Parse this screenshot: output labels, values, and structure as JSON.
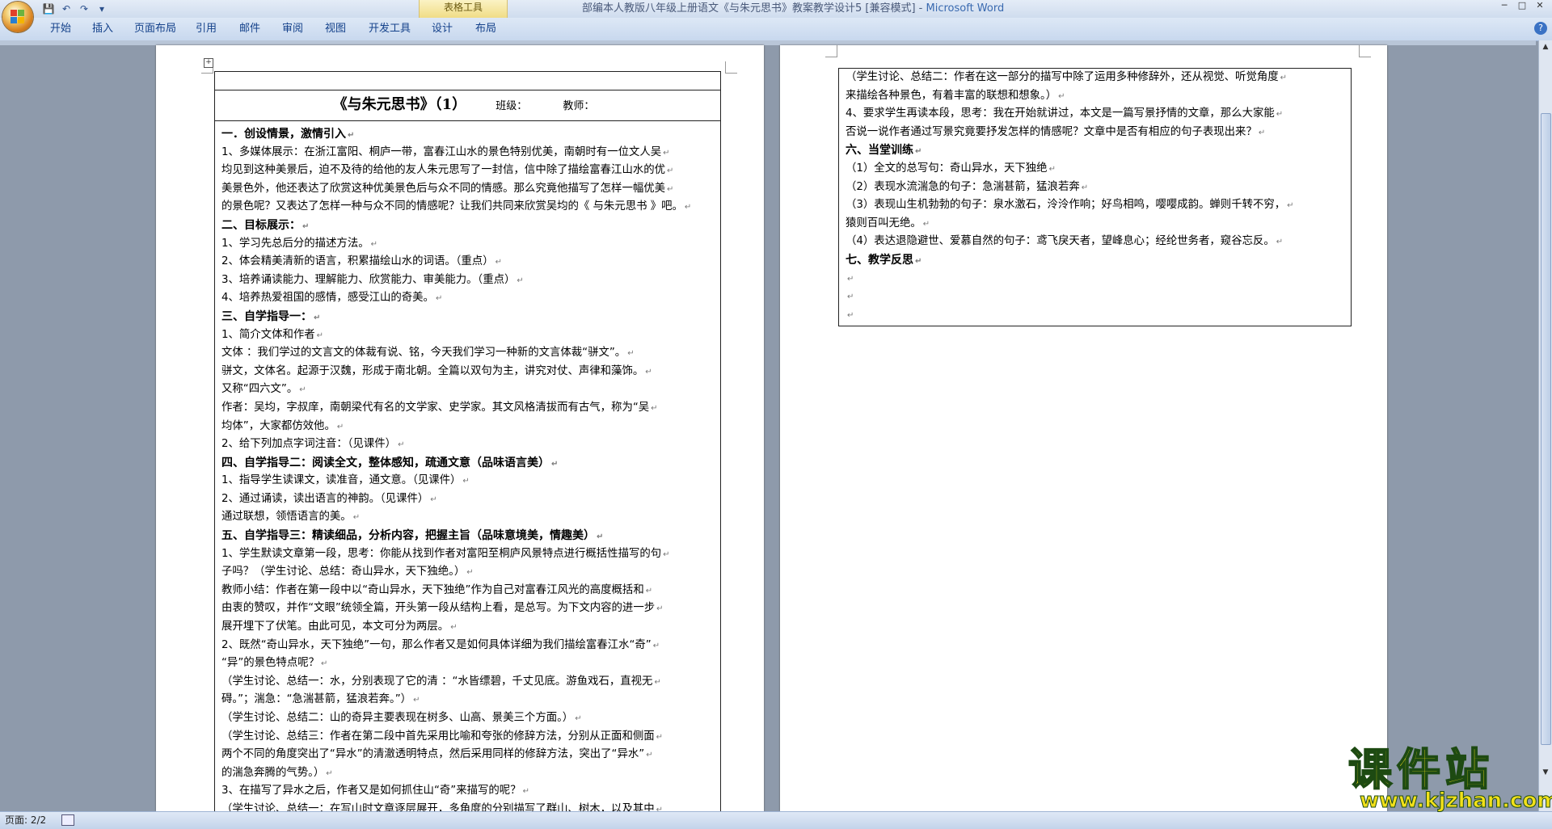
{
  "titlebar": {
    "context_tab_group": "表格工具",
    "doc_title": "部编本人教版八年级上册语文《与朱元思书》教案教学设计5 [兼容模式] - ",
    "app_name": "Microsoft Word",
    "minimize": "─",
    "maximize": "□",
    "close": "✕"
  },
  "qat": {
    "save": "💾",
    "undo": "↶",
    "redo": "↷",
    "customize": "▾"
  },
  "ribbon": {
    "tabs": [
      "开始",
      "插入",
      "页面布局",
      "引用",
      "邮件",
      "审阅",
      "视图",
      "开发工具",
      "设计",
      "布局"
    ],
    "help": "?"
  },
  "page1": {
    "header": {
      "title": "《与朱元思书》（1）",
      "class_label": "班级：",
      "teacher_label": "教师："
    },
    "lines": [
      {
        "t": "一．创设情景，激情引入",
        "h": true
      },
      {
        "t": "1、多媒体展示：在浙江富阳、桐庐一带，富春江山水的景色特别优美，南朝时有一位文人吴"
      },
      {
        "t": "均见到这种美景后，迫不及待的给他的友人朱元思写了一封信，信中除了描绘富春江山水的优"
      },
      {
        "t": "美景色外，他还表达了欣赏这种优美景色后与众不同的情感。那么究竟他描写了怎样一幅优美"
      },
      {
        "t": "的景色呢？又表达了怎样一种与众不同的情感呢？让我们共同来欣赏吴均的《 与朱元思书 》吧。"
      },
      {
        "t": "二、目标展示：",
        "h": true
      },
      {
        "t": "1、学习先总后分的描述方法。"
      },
      {
        "t": "2、体会精美清新的语言，积累描绘山水的词语。（重点）"
      },
      {
        "t": "3、培养诵读能力、理解能力、欣赏能力、审美能力。（重点）"
      },
      {
        "t": "4、培养热爱祖国的感情，感受江山的奇美。"
      },
      {
        "t": "三、自学指导一：",
        "h": true
      },
      {
        "t": "1、简介文体和作者"
      },
      {
        "t": "   文体 ：我们学过的文言文的体裁有说、铭，今天我们学习一种新的文言体裁“骈文”。"
      },
      {
        "t": "       骈文，文体名。起源于汉魏，形成于南北朝。全篇以双句为主，讲究对仗、声律和藻饰。"
      },
      {
        "t": "又称“四六文”。"
      },
      {
        "t": "   作者：吴均，字叔庠，南朝梁代有名的文学家、史学家。其文风格清拔而有古气，称为“吴"
      },
      {
        "t": "均体”，大家都仿效他。"
      },
      {
        "t": "2、给下列加点字词注音：（见课件）"
      },
      {
        "t": "四、自学指导二：阅读全文，整体感知，疏通文意（品味语言美）",
        "h": true
      },
      {
        "t": "1、指导学生读课文，读准音，通文意。（见课件）"
      },
      {
        "t": "2、通过诵读，读出语言的神韵。（见课件）"
      },
      {
        "t": "   通过联想，领悟语言的美。"
      },
      {
        "t": "五、自学指导三：精读细品，分析内容，把握主旨（品味意境美，情趣美）",
        "h": true
      },
      {
        "t": " 1、学生默读文章第一段，思考：你能从找到作者对富阳至桐庐风景特点进行概括性描写的句"
      },
      {
        "t": "子吗？（学生讨论、总结：奇山异水，天下独绝。）"
      },
      {
        "t": " 教师小结：作者在第一段中以“奇山异水，天下独绝”作为自己对富春江风光的高度概括和"
      },
      {
        "t": "由衷的赞叹，并作“文眼”统领全篇，开头第一段从结构上看，是总写。为下文内容的进一步"
      },
      {
        "t": "展开埋下了伏笔。由此可见，本文可分为两层。"
      },
      {
        "t": " 2、既然“奇山异水，天下独绝”一句，那么作者又是如何具体详细为我们描绘富春江水“奇”"
      },
      {
        "t": "“异”的景色特点呢？"
      },
      {
        "t": " （学生讨论、总结一：水，分别表现了它的清 ：“水皆缥碧，千丈见底。游鱼戏石，直视无"
      },
      {
        "t": "碍。”；湍急：“急湍甚箭，猛浪若奔。”）"
      },
      {
        "t": " （学生讨论、总结二：山的奇异主要表现在树多、山高、景美三个方面。）"
      },
      {
        "t": " （学生讨论、总结三：作者在第二段中首先采用比喻和夸张的修辞方法，分别从正面和侧面"
      },
      {
        "t": "两个不同的角度突出了“异水”的清澈透明特点，然后采用同样的修辞方法，突出了“异水”"
      },
      {
        "t": "的湍急奔腾的气势。）"
      },
      {
        "t": "   3、在描写了异水之后，作者又是如何抓住山“奇”来描写的呢？"
      },
      {
        "t": " （学生讨论、总结一：在写山时文章逐层展开，多角度的分别描写了群山、树木，以及其中"
      }
    ]
  },
  "page2": {
    "lines": [
      {
        "t": "  （学生讨论、总结二：作者在这一部分的描写中除了运用多种修辞外，还从视觉、听觉角度"
      },
      {
        "t": "来描绘各种景色，有着丰富的联想和想象。）"
      },
      {
        "t": "      4、要求学生再读本段，思考：我在开始就讲过，本文是一篇写景抒情的文章，那么大家能"
      },
      {
        "t": "否说一说作者通过写景究竟要抒发怎样的情感呢？文章中是否有相应的句子表现出来？"
      },
      {
        "t": "六、当堂训练",
        "h": true
      },
      {
        "t": "  （1）全文的总写句：奇山异水，天下独绝"
      },
      {
        "t": "  （2）表现水流湍急的句子：急湍甚箭，猛浪若奔"
      },
      {
        "t": "  （3）表现山生机勃勃的句子：泉水激石，泠泠作响；好鸟相鸣，嘤嘤成韵。蝉则千转不穷，"
      },
      {
        "t": "猿则百叫无绝。"
      },
      {
        "t": "  （4）表达退隐避世、爱慕自然的句子：鸢飞戾天者，望峰息心；经纶世务者，窥谷忘反。"
      },
      {
        "t": "七、教学反思",
        "h": true
      },
      {
        "t": ""
      },
      {
        "t": ""
      },
      {
        "t": ""
      }
    ]
  },
  "statusbar": {
    "page": "页面: 2/2"
  },
  "watermark": {
    "main": "课件站",
    "url": "www.kjzhan.com"
  }
}
